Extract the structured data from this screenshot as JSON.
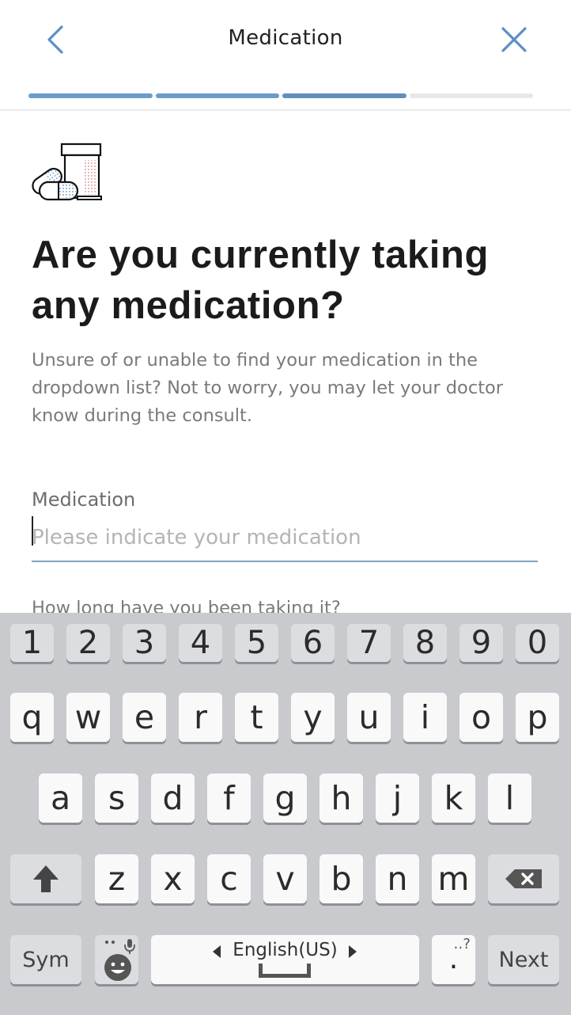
{
  "header": {
    "title": "Medication",
    "back_icon": "chevron-left-icon",
    "close_icon": "close-icon",
    "accent": "#6b9ccc",
    "progress": {
      "total_steps": 4,
      "completed": 3
    }
  },
  "illustration": {
    "icon": "medication-bottle-pills-icon"
  },
  "question": {
    "title": "Are you currently taking any medication?",
    "description": "Unsure of or unable to find your medication in the dropdown list? Not to worry, you may let your doctor know during the consult."
  },
  "medication_field": {
    "label": "Medication",
    "placeholder": "Please indicate your medication",
    "value": ""
  },
  "duration_field": {
    "label": "How long have you been taking it?"
  },
  "keyboard": {
    "numbers": [
      "1",
      "2",
      "3",
      "4",
      "5",
      "6",
      "7",
      "8",
      "9",
      "0"
    ],
    "row1": [
      "q",
      "w",
      "e",
      "r",
      "t",
      "y",
      "u",
      "i",
      "o",
      "p"
    ],
    "row2": [
      "a",
      "s",
      "d",
      "f",
      "g",
      "h",
      "j",
      "k",
      "l"
    ],
    "row3": [
      "z",
      "x",
      "c",
      "v",
      "b",
      "n",
      "m"
    ],
    "sym_label": "Sym",
    "space_label": "English(US)",
    "punct_label": ".",
    "punct_alt": "‥?",
    "next_label": "Next",
    "shift_icon": "shift-arrow-icon",
    "backspace_icon": "backspace-icon",
    "emoji_icon": "emoji-mic-icon"
  }
}
